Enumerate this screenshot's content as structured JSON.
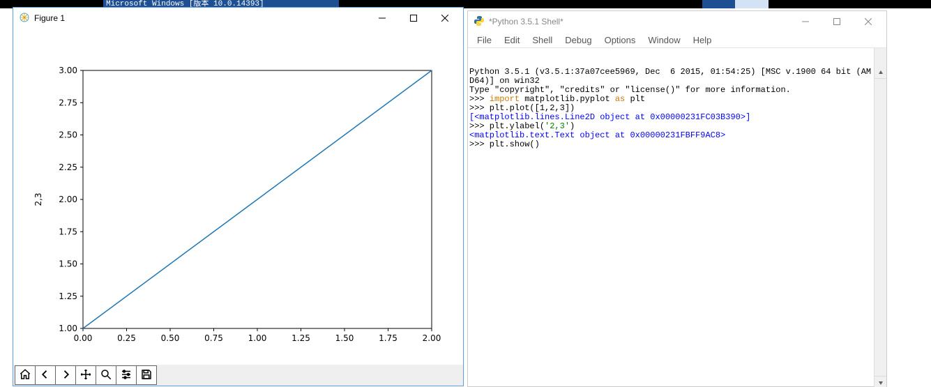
{
  "taskbar": {
    "tab1": "Microsoft Windows [版本 10.0.14393]",
    "tab2": "",
    "tab3": ""
  },
  "figure_window": {
    "title": "Figure 1",
    "toolbar": {
      "home": "home-icon",
      "back": "back-icon",
      "forward": "forward-icon",
      "pan": "pan-icon",
      "zoom": "zoom-icon",
      "configure": "configure-icon",
      "save": "save-icon"
    }
  },
  "shell_window": {
    "title": "*Python 3.5.1 Shell*",
    "menu": [
      "File",
      "Edit",
      "Shell",
      "Debug",
      "Options",
      "Window",
      "Help"
    ],
    "lines": [
      [
        {
          "c": "cBlack",
          "t": "Python 3.5.1 (v3.5.1:37a07cee5969, Dec  6 2015, 01:54:25) [MSC v.1900 64 bit (AM"
        }
      ],
      [
        {
          "c": "cBlack",
          "t": "D64)] on win32"
        }
      ],
      [
        {
          "c": "cBlack",
          "t": "Type \"copyright\", \"credits\" or \"license()\" for more information."
        }
      ],
      [
        {
          "c": "cBlack",
          "t": ">>> "
        },
        {
          "c": "cOrange",
          "t": "import"
        },
        {
          "c": "cBlack",
          "t": " matplotlib.pyplot "
        },
        {
          "c": "cOrange",
          "t": "as"
        },
        {
          "c": "cBlack",
          "t": " plt"
        }
      ],
      [
        {
          "c": "cBlack",
          "t": ">>> plt.plot([1,2,3])"
        }
      ],
      [
        {
          "c": "cBlue",
          "t": "[<matplotlib.lines.Line2D object at 0x00000231FC03B390>]"
        }
      ],
      [
        {
          "c": "cBlack",
          "t": ">>> plt.ylabel("
        },
        {
          "c": "cGreen",
          "t": "'2,3'"
        },
        {
          "c": "cBlack",
          "t": ")"
        }
      ],
      [
        {
          "c": "cBlue",
          "t": "<matplotlib.text.Text object at 0x00000231FBFF9AC8>"
        }
      ],
      [
        {
          "c": "cBlack",
          "t": ">>> plt.show()"
        }
      ]
    ]
  },
  "chart_data": {
    "type": "line",
    "x": [
      0,
      1,
      2
    ],
    "values": [
      1,
      2,
      3
    ],
    "ylabel": "2,3",
    "xlabel": "",
    "title": "",
    "xlim": [
      0,
      2
    ],
    "ylim": [
      1,
      3
    ],
    "xticks": [
      0.0,
      0.25,
      0.5,
      0.75,
      1.0,
      1.25,
      1.5,
      1.75,
      2.0
    ],
    "yticks": [
      1.0,
      1.25,
      1.5,
      1.75,
      2.0,
      2.25,
      2.5,
      2.75,
      3.0
    ],
    "xtick_labels": [
      "0.00",
      "0.25",
      "0.50",
      "0.75",
      "1.00",
      "1.25",
      "1.50",
      "1.75",
      "2.00"
    ],
    "ytick_labels": [
      "1.00",
      "1.25",
      "1.50",
      "1.75",
      "2.00",
      "2.25",
      "2.50",
      "2.75",
      "3.00"
    ],
    "line_color": "#1f77b4"
  }
}
